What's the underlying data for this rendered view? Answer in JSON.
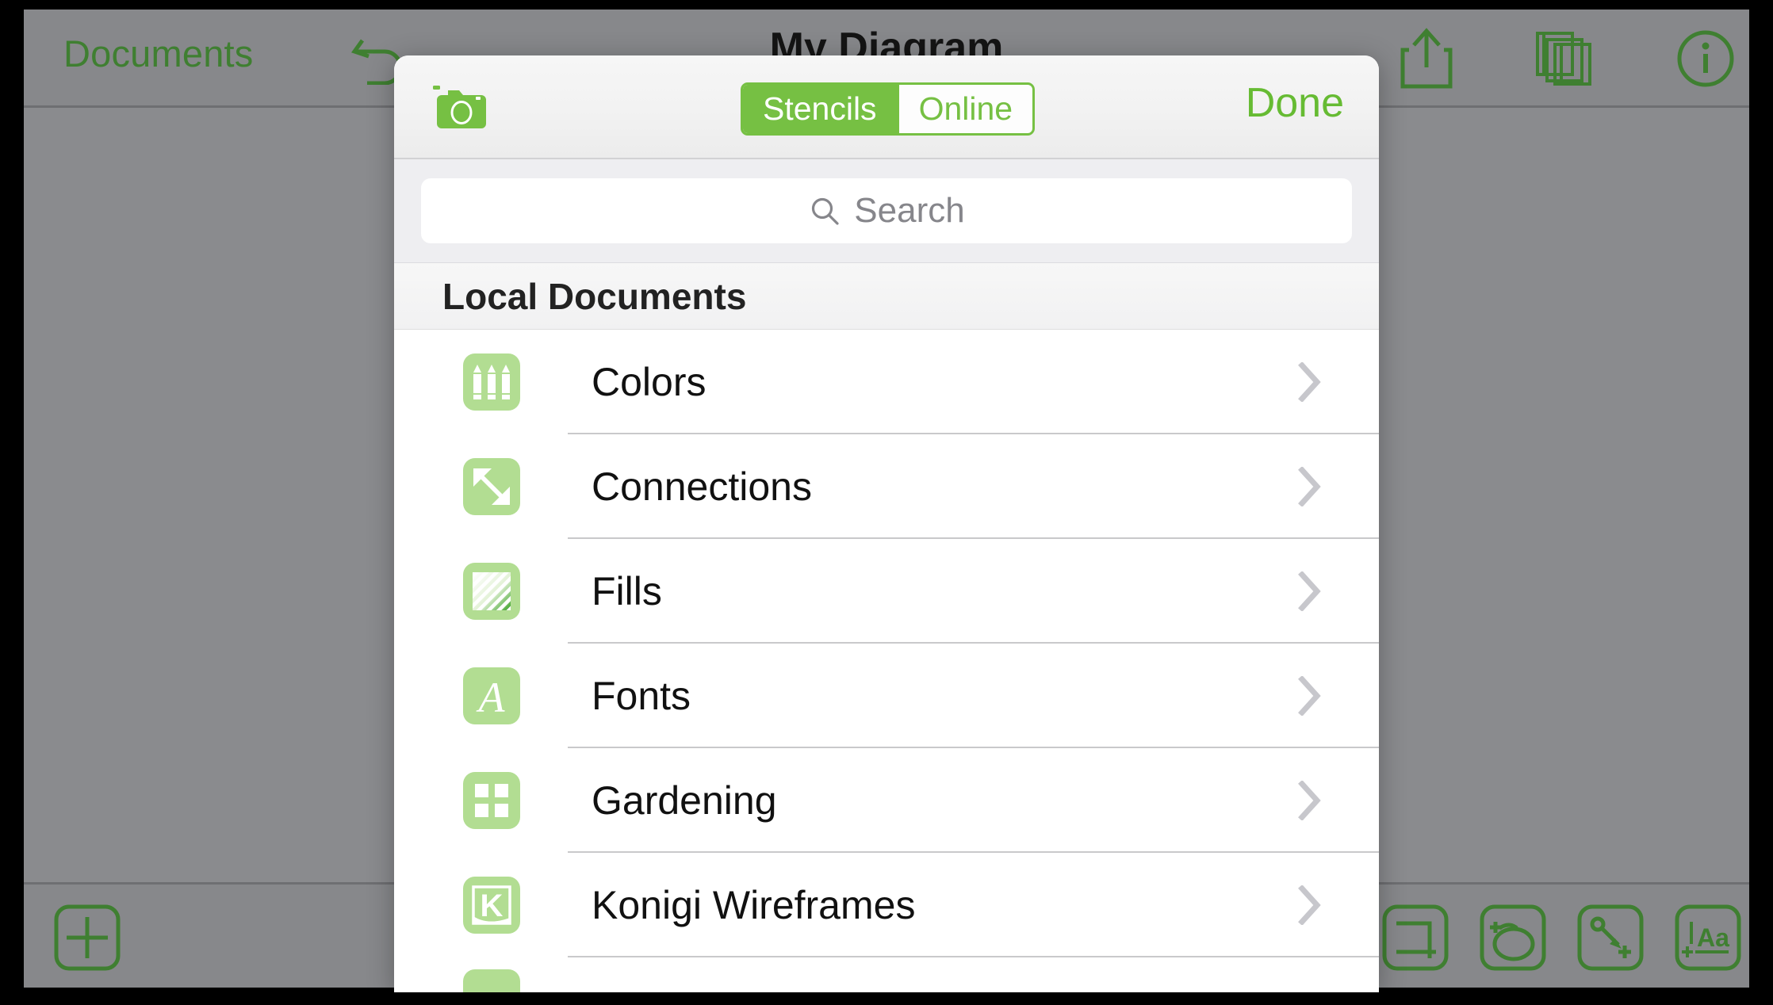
{
  "app": {
    "back_label": "Documents",
    "title": "My Diagram",
    "undo_icon": "undo-arrow-icon",
    "share_icon": "share-icon",
    "layers_icon": "documents-stack-icon",
    "info_icon": "info-icon",
    "add_icon": "plus-square-icon",
    "tools": [
      {
        "icon": "add-rectangle-icon"
      },
      {
        "icon": "add-ellipse-icon"
      },
      {
        "icon": "add-line-icon"
      },
      {
        "icon": "add-text-icon"
      }
    ]
  },
  "sheet": {
    "camera_icon": "camera-icon",
    "segments": [
      {
        "label": "Stencils",
        "selected": true
      },
      {
        "label": "Online",
        "selected": false
      }
    ],
    "done_label": "Done",
    "search": {
      "icon": "search-icon",
      "value": "",
      "placeholder": "Search"
    },
    "section_title": "Local Documents",
    "items": [
      {
        "label": "Colors",
        "icon": "crayons-icon",
        "chevron": "chevron-right-icon"
      },
      {
        "label": "Connections",
        "icon": "diagonal-arrow-icon",
        "chevron": "chevron-right-icon"
      },
      {
        "label": "Fills",
        "icon": "stripes-icon",
        "chevron": "chevron-right-icon"
      },
      {
        "label": "Fonts",
        "icon": "letter-a-icon",
        "chevron": "chevron-right-icon"
      },
      {
        "label": "Gardening",
        "icon": "grid-squares-icon",
        "chevron": "chevron-right-icon"
      },
      {
        "label": "Konigi Wireframes",
        "icon": "letter-k-icon",
        "chevron": "chevron-right-icon"
      }
    ]
  },
  "colors": {
    "accent_green": "#76c043",
    "toolbar_green": "#3f7f31",
    "icon_tile_green": "#b2dd92",
    "chrome_gray": "#87888b"
  }
}
